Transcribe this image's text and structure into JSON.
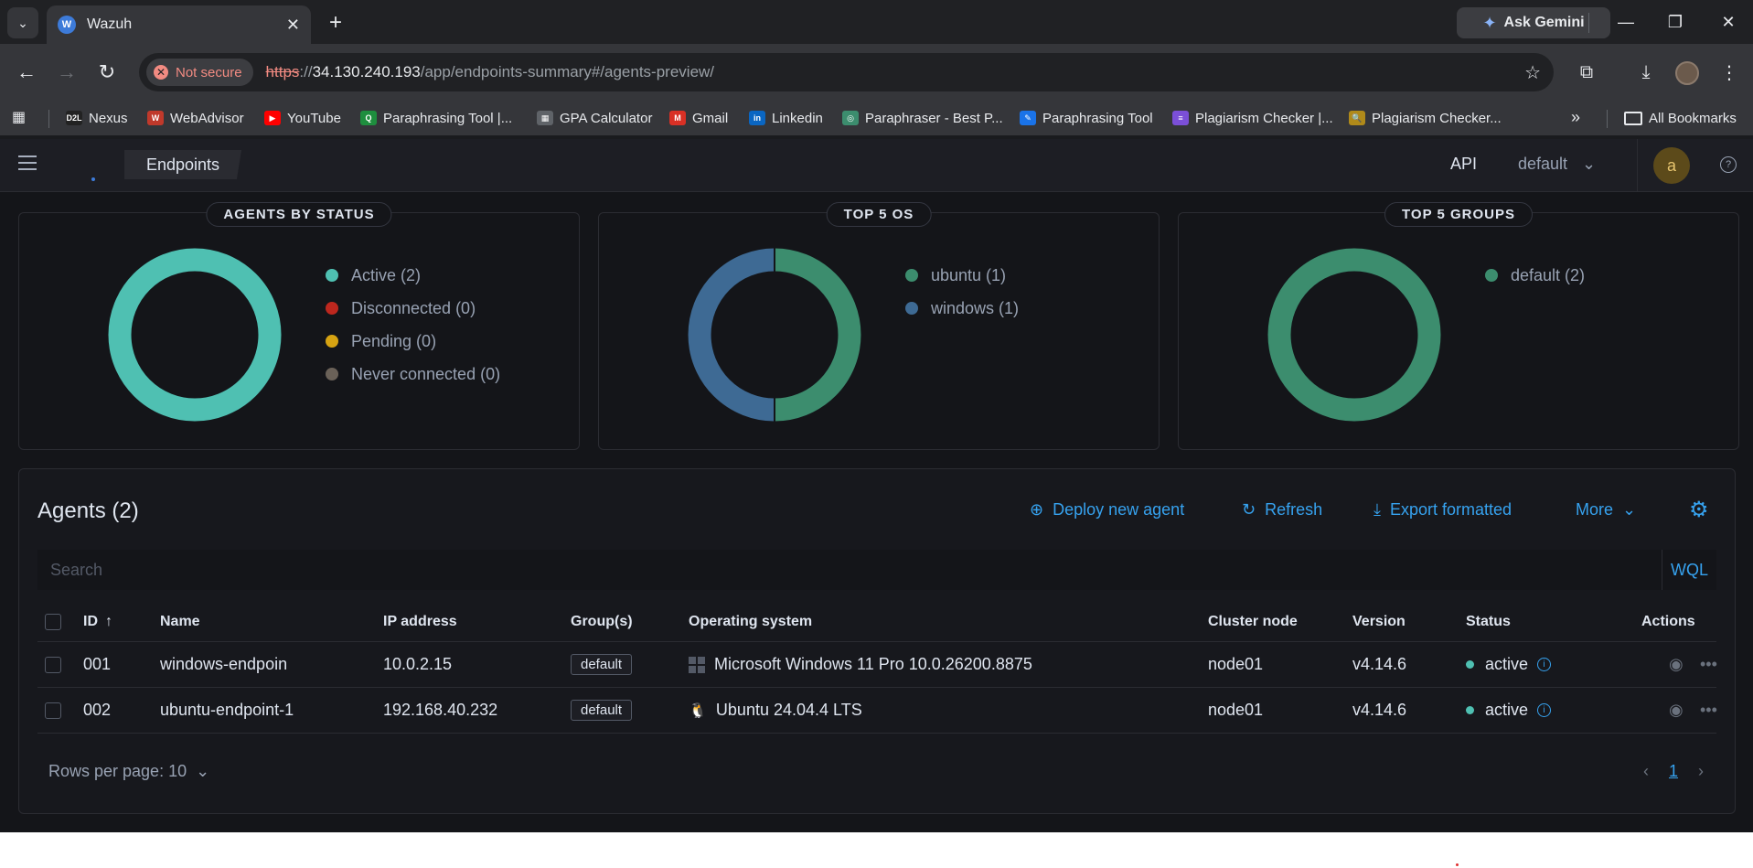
{
  "browser": {
    "tab_title": "Wazuh",
    "tab_favicon": "W",
    "gemini_label": "Ask Gemini",
    "security_label": "Not secure",
    "url_scheme": "https",
    "url_sep": "://",
    "url_host": "34.130.240.193",
    "url_path": "/app/endpoints-summary#/agents-preview/",
    "bookmarks": [
      {
        "label": "Nexus",
        "icon": "D2L",
        "color": "#222222"
      },
      {
        "label": "WebAdvisor",
        "icon": "W",
        "color": "#c0392b"
      },
      {
        "label": "YouTube",
        "icon": "▶",
        "color": "#ff0000"
      },
      {
        "label": "Paraphrasing Tool |...",
        "icon": "Q",
        "color": "#1e8e3e"
      },
      {
        "label": "GPA Calculator",
        "icon": "▦",
        "color": "#5f6368"
      },
      {
        "label": "Gmail",
        "icon": "M",
        "color": "#d93025"
      },
      {
        "label": "Linkedin",
        "icon": "in",
        "color": "#0a66c2"
      },
      {
        "label": "Paraphraser - Best P...",
        "icon": "◎",
        "color": "#3c8d6e"
      },
      {
        "label": "Paraphrasing Tool",
        "icon": "✎",
        "color": "#1a73e8"
      },
      {
        "label": "Plagiarism Checker |...",
        "icon": "≡",
        "color": "#7b4fd8"
      },
      {
        "label": "Plagiarism Checker...",
        "icon": "🔍",
        "color": "#b08a1a"
      }
    ],
    "all_bookmarks": "All Bookmarks"
  },
  "app": {
    "breadcrumb": "Endpoints",
    "api_label": "API",
    "api_value": "default",
    "avatar_letter": "a",
    "help": "?"
  },
  "panels": {
    "status": {
      "title": "AGENTS BY STATUS",
      "legend": [
        {
          "label": "Active (2)",
          "color": "#4fc0b2"
        },
        {
          "label": "Disconnected (0)",
          "color": "#bd271e"
        },
        {
          "label": "Pending (0)",
          "color": "#d6a312"
        },
        {
          "label": "Never connected (0)",
          "color": "#6a6158"
        }
      ]
    },
    "os": {
      "title": "TOP 5 OS",
      "legend": [
        {
          "label": "ubuntu (1)",
          "color": "#3c8d6e"
        },
        {
          "label": "windows (1)",
          "color": "#3e6a94"
        }
      ]
    },
    "groups": {
      "title": "TOP 5 GROUPS",
      "legend": [
        {
          "label": "default (2)",
          "color": "#3c8d6e"
        }
      ]
    }
  },
  "agents": {
    "title": "Agents (2)",
    "deploy": "Deploy new agent",
    "refresh": "Refresh",
    "export": "Export formatted",
    "more": "More",
    "search_placeholder": "Search",
    "wql": "WQL",
    "columns": {
      "id": "ID",
      "name": "Name",
      "ip": "IP address",
      "groups": "Group(s)",
      "os": "Operating system",
      "cluster": "Cluster node",
      "version": "Version",
      "status": "Status",
      "actions": "Actions"
    },
    "rows": [
      {
        "id": "001",
        "name": "windows-endpoin",
        "ip": "10.0.2.15",
        "group": "default",
        "os": "Microsoft Windows 11 Pro 10.0.26200.8875",
        "os_icon": "windows-icon",
        "cluster": "node01",
        "version": "v4.14.6",
        "status": "active"
      },
      {
        "id": "002",
        "name": "ubuntu-endpoint-1",
        "ip": "192.168.40.232",
        "group": "default",
        "os": "Ubuntu 24.04.4 LTS",
        "os_icon": "linux-icon",
        "cluster": "node01",
        "version": "v4.14.6",
        "status": "active"
      }
    ],
    "rows_per_page": "Rows per page: 10",
    "current_page": "1"
  }
}
